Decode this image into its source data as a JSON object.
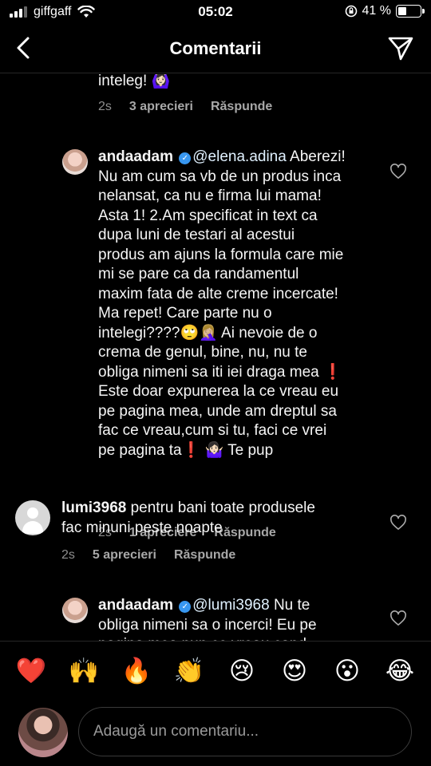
{
  "status_bar": {
    "carrier": "giffgaff",
    "time": "05:02",
    "battery": "41 %",
    "battery_level": 0.41
  },
  "header": {
    "title": "Comentarii",
    "back_icon": "back-arrow-icon",
    "share_icon": "paper-plane-icon"
  },
  "comments": [
    {
      "text_tail": "inteleg! 🙆🏻‍♀️",
      "time": "2s",
      "likes": "3 aprecieri",
      "reply": "Răspunde"
    },
    {
      "username": "andaadam",
      "verified": true,
      "mention": "@elena.adina",
      "body": " Aberezi!\nNu am cum sa vb de un produs inca\nnelansat, ca nu e firma lui mama!\nAsta 1! 2.Am specificat in text ca\ndupa luni de testari al acestui\nprodus am ajuns la formula care mie\nmi se pare ca da randamentul\nmaxim fata de alte creme incercate!\nMa repet! Care parte nu o\nintelegi????🙄🤦🏼‍♀️  Ai nevoie de o\ncrema de genul, bine, nu, nu te\nobliga nimeni sa iti iei draga mea ❗\nEste doar expunerea la ce vreau eu\npe pagina mea, unde am dreptul sa\nfac ce vreau,cum si tu,  faci ce vrei\npe pagina ta❗ 🤷🏻‍♀️  Te pup",
      "time": "2s",
      "likes": "1 apreciere",
      "reply": "Răspunde"
    },
    {
      "username": "lumi3968",
      "body": " pentru bani toate produsele\nfac minuni peste noapte",
      "time": "2s",
      "likes": "5 aprecieri",
      "reply": "Răspunde"
    },
    {
      "username": "andaadam",
      "verified": true,
      "mention": "@lumi3968",
      "body": " Nu te\nobliga nimeni sa o incerci! Eu pe\npagina mea pun ce vreau cand"
    }
  ],
  "emoji_bar": [
    "❤️",
    "🙌",
    "🔥",
    "👏",
    "😢",
    "😍",
    "😮",
    "😂"
  ],
  "input": {
    "placeholder": "Adaugă un comentariu..."
  }
}
